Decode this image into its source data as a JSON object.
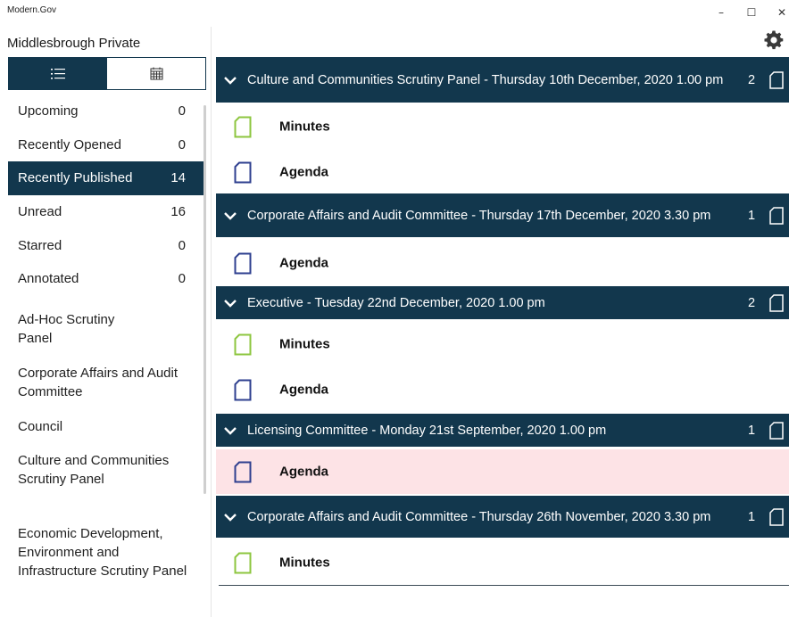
{
  "window": {
    "title": "Modern.Gov",
    "minimize_glyph": "–",
    "maximize_glyph": "☐",
    "close_glyph": "✕"
  },
  "sidebar": {
    "site_name": "Middlesbrough Private",
    "view_toggle": {
      "list_icon": "list-icon",
      "calendar_icon": "calendar-icon",
      "active": "list"
    },
    "filters": [
      {
        "label": "Upcoming",
        "count": "0"
      },
      {
        "label": "Recently Opened",
        "count": "0"
      },
      {
        "label": "Recently Published",
        "count": "14",
        "selected": true
      },
      {
        "label": "Unread",
        "count": "16"
      },
      {
        "label": "Starred",
        "count": "0"
      },
      {
        "label": "Annotated",
        "count": "0"
      }
    ],
    "committees": [
      "Ad-Hoc Scrutiny Panel",
      "Corporate Affairs and Audit Committee",
      "Council",
      "Culture and Communities Scrutiny Panel",
      "Economic Development, Environment and Infrastructure Scrutiny Panel"
    ]
  },
  "main": {
    "settings_icon": "gear-icon",
    "meetings": [
      {
        "title": "Culture and Communities Scrutiny Panel - Thursday 10th December, 2020 1.00 pm",
        "count": "2",
        "documents": [
          {
            "label": "Minutes",
            "color": "#8dc63f"
          },
          {
            "label": "Agenda",
            "color": "#2e3f8f"
          }
        ]
      },
      {
        "title": "Corporate Affairs and Audit Committee - Thursday 17th December, 2020 3.30 pm",
        "count": "1",
        "documents": [
          {
            "label": "Agenda",
            "color": "#2e3f8f"
          }
        ]
      },
      {
        "title": "Executive - Tuesday 22nd December, 2020 1.00 pm",
        "count": "2",
        "documents": [
          {
            "label": "Minutes",
            "color": "#8dc63f"
          },
          {
            "label": "Agenda",
            "color": "#2e3f8f"
          }
        ]
      },
      {
        "title": "Licensing Committee - Monday 21st September, 2020 1.00 pm",
        "count": "1",
        "documents": [
          {
            "label": "Agenda",
            "color": "#2e3f8f",
            "highlighted": true
          }
        ]
      },
      {
        "title": "Corporate Affairs and Audit Committee - Thursday 26th November, 2020 3.30 pm",
        "count": "1",
        "documents": [
          {
            "label": "Minutes",
            "color": "#8dc63f"
          }
        ]
      }
    ]
  },
  "colors": {
    "header_bg": "#12374d",
    "selected_bg": "#12374d",
    "highlight_row": "#fde3e6",
    "minutes_icon": "#8dc63f",
    "agenda_icon": "#2e3f8f"
  }
}
